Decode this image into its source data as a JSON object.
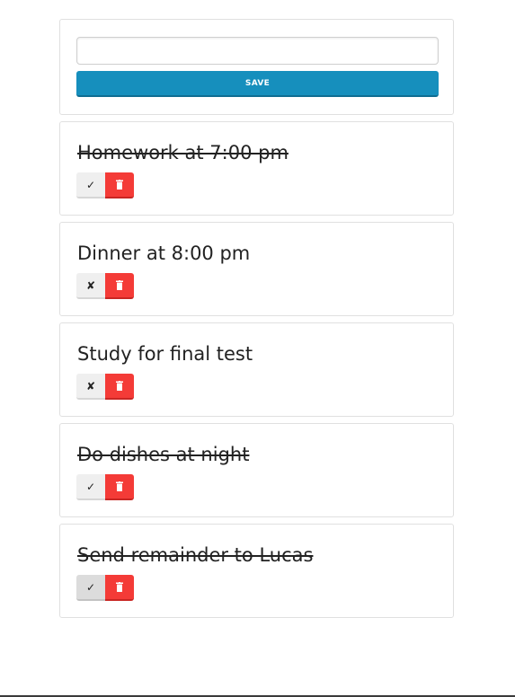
{
  "form": {
    "input_value": "",
    "input_placeholder": "",
    "save_label": "SAVE"
  },
  "tasks": [
    {
      "text": "Homework at 7:00 pm",
      "done": true,
      "toggle_symbol": "✓"
    },
    {
      "text": "Dinner at 8:00 pm",
      "done": false,
      "toggle_symbol": "✘"
    },
    {
      "text": "Study for final test",
      "done": false,
      "toggle_symbol": "✘"
    },
    {
      "text": "Do dishes at night",
      "done": true,
      "toggle_symbol": "✓"
    },
    {
      "text": "Send remainder to Lucas",
      "done": true,
      "toggle_symbol": "✓"
    }
  ],
  "icons": {
    "toggle_done": "check-icon",
    "toggle_undone": "cross-icon",
    "delete": "trash-icon"
  },
  "colors": {
    "save_button": "#168fbd",
    "delete_button": "#f43b37",
    "toggle_button": "#efefef"
  }
}
